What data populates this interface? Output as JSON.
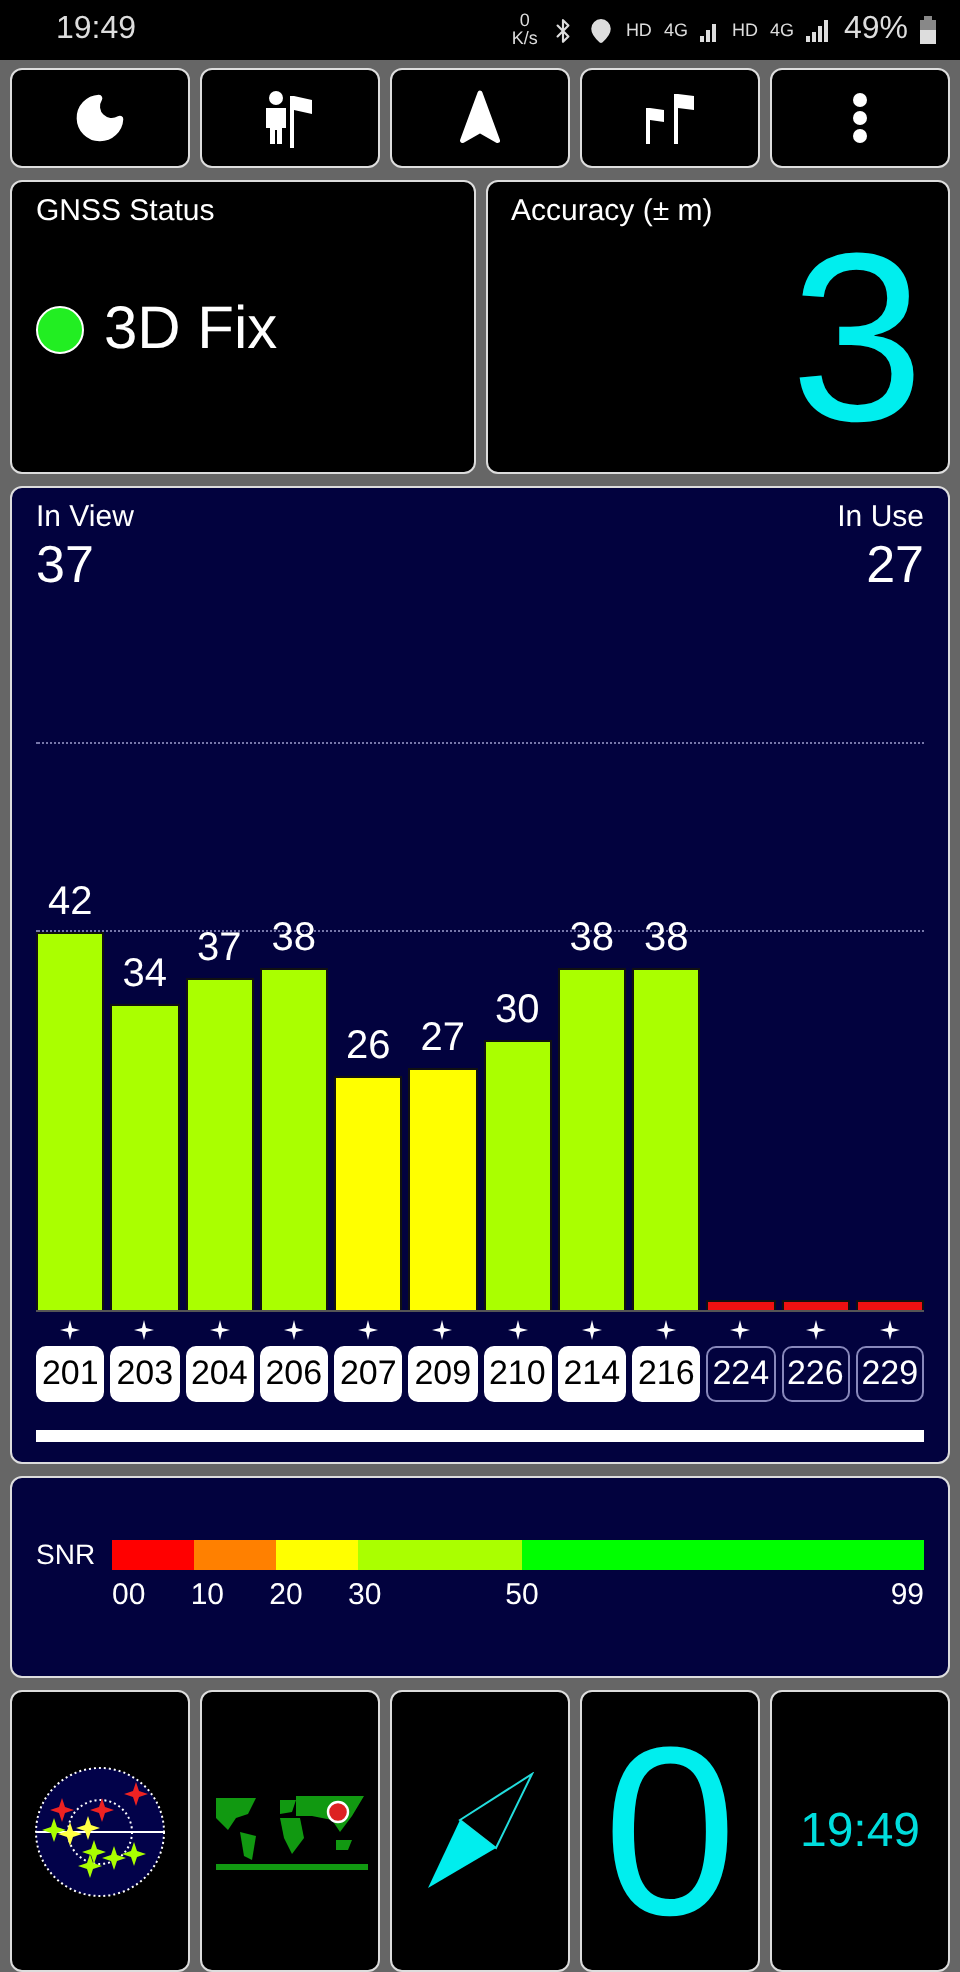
{
  "status_bar": {
    "time": "19:49",
    "speed_value": "0",
    "speed_unit": "K/s",
    "hd_1": "HD",
    "network_1": "4G",
    "hd_2": "HD",
    "network_2": "4G",
    "battery": "49%"
  },
  "toolbar": [
    {
      "kind": "moon"
    },
    {
      "kind": "person-flag"
    },
    {
      "kind": "arrow"
    },
    {
      "kind": "flags"
    },
    {
      "kind": "more"
    }
  ],
  "gnss_status": {
    "title": "GNSS Status",
    "fix": "3D Fix",
    "color": "#22ee22"
  },
  "accuracy": {
    "title": "Accuracy (± m)",
    "value": "3"
  },
  "satellites": {
    "in_view_label": "In View",
    "in_view": "37",
    "in_use_label": "In Use",
    "in_use": "27",
    "items": [
      {
        "id": "201",
        "snr": "42",
        "used": true
      },
      {
        "id": "203",
        "snr": "34",
        "used": true
      },
      {
        "id": "204",
        "snr": "37",
        "used": true
      },
      {
        "id": "206",
        "snr": "38",
        "used": true
      },
      {
        "id": "207",
        "snr": "26",
        "used": true
      },
      {
        "id": "209",
        "snr": "27",
        "used": true
      },
      {
        "id": "210",
        "snr": "30",
        "used": true
      },
      {
        "id": "214",
        "snr": "38",
        "used": true
      },
      {
        "id": "216",
        "snr": "38",
        "used": true
      },
      {
        "id": "224",
        "used": false
      },
      {
        "id": "226",
        "used": false
      },
      {
        "id": "229",
        "used": false
      }
    ]
  },
  "snr_legend": {
    "label": "SNR",
    "segments": [
      {
        "from": "00",
        "color": "#ff0000"
      },
      {
        "from": "10",
        "color": "#ff8000"
      },
      {
        "from": "20",
        "color": "#ffff00"
      },
      {
        "from": "30",
        "color": "#aaff00"
      },
      {
        "from": "50",
        "color": "#00ff00"
      }
    ],
    "end": "99"
  },
  "tiles": [
    {
      "kind": "radar"
    },
    {
      "kind": "map"
    },
    {
      "kind": "compass"
    },
    {
      "kind": "number",
      "text": "0"
    },
    {
      "kind": "clock",
      "text": "19:49"
    }
  ]
}
